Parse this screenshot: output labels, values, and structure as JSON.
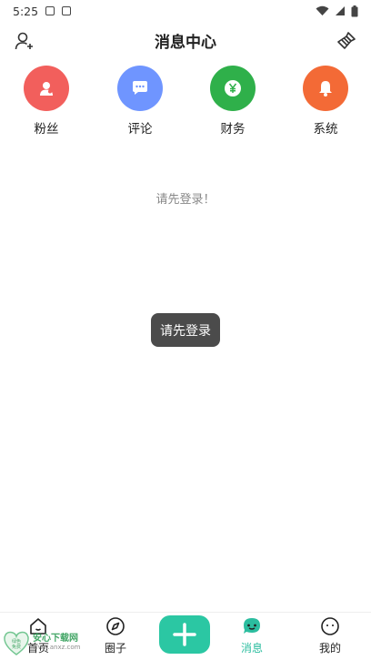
{
  "status_bar": {
    "time": "5:25"
  },
  "header": {
    "title": "消息中心"
  },
  "categories": [
    {
      "label": "粉丝",
      "color": "#f25f5c",
      "icon": "user-icon"
    },
    {
      "label": "评论",
      "color": "#6f95ff",
      "icon": "comment-icon"
    },
    {
      "label": "财务",
      "color": "#2fb04a",
      "icon": "yen-icon"
    },
    {
      "label": "系统",
      "color": "#f36a36",
      "icon": "bell-icon"
    }
  ],
  "empty_message": "请先登录！",
  "toast": "请先登录",
  "tabs": [
    {
      "label": "首页",
      "icon": "home-icon"
    },
    {
      "label": "圈子",
      "icon": "compass-icon"
    },
    {
      "label": "消息",
      "icon": "message-icon",
      "active": true
    },
    {
      "label": "我的",
      "icon": "smile-icon"
    }
  ],
  "add_button": {
    "icon": "plus-icon",
    "color": "#2bc7a3"
  },
  "watermark": {
    "title": "安心下载网",
    "subtitle": "www.anxz.com",
    "logo_text": "绿色 免费"
  },
  "colors": {
    "accent": "#2bbd9f"
  }
}
